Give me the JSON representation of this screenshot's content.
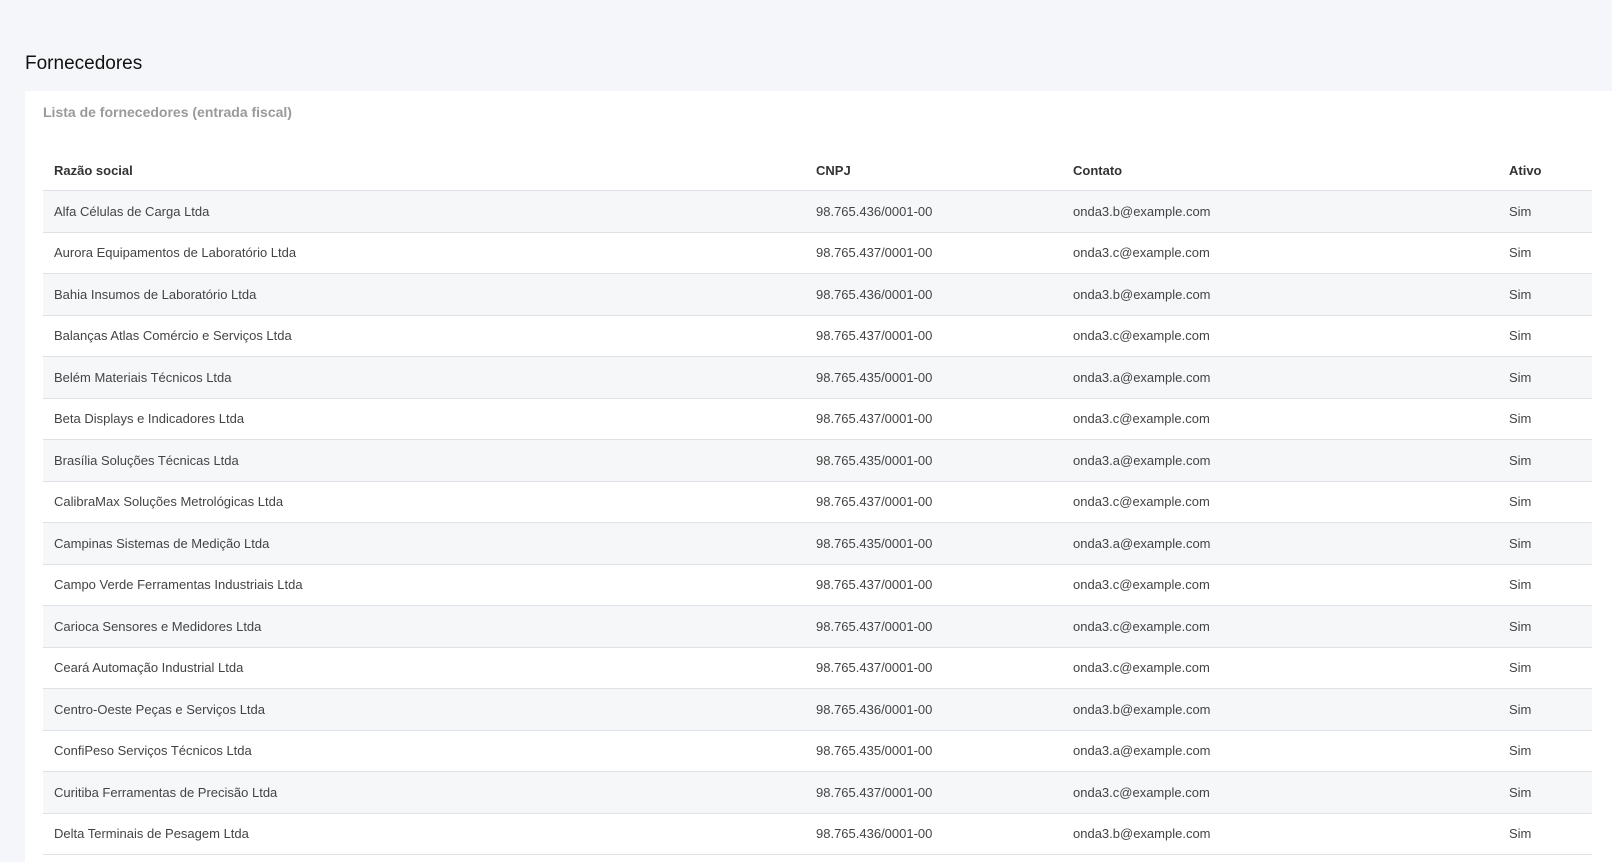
{
  "page": {
    "title": "Fornecedores"
  },
  "card": {
    "subtitle": "Lista de fornecedores (entrada fiscal)"
  },
  "table": {
    "columns": [
      "Razão social",
      "CNPJ",
      "Contato",
      "Ativo"
    ],
    "rows": [
      [
        "Alfa Células de Carga Ltda",
        "98.765.436/0001-00",
        "onda3.b@example.com",
        "Sim"
      ],
      [
        "Aurora Equipamentos de Laboratório Ltda",
        "98.765.437/0001-00",
        "onda3.c@example.com",
        "Sim"
      ],
      [
        "Bahia Insumos de Laboratório Ltda",
        "98.765.436/0001-00",
        "onda3.b@example.com",
        "Sim"
      ],
      [
        "Balanças Atlas Comércio e Serviços Ltda",
        "98.765.437/0001-00",
        "onda3.c@example.com",
        "Sim"
      ],
      [
        "Belém Materiais Técnicos Ltda",
        "98.765.435/0001-00",
        "onda3.a@example.com",
        "Sim"
      ],
      [
        "Beta Displays e Indicadores Ltda",
        "98.765.437/0001-00",
        "onda3.c@example.com",
        "Sim"
      ],
      [
        "Brasília Soluções Técnicas Ltda",
        "98.765.435/0001-00",
        "onda3.a@example.com",
        "Sim"
      ],
      [
        "CalibraMax Soluções Metrológicas Ltda",
        "98.765.437/0001-00",
        "onda3.c@example.com",
        "Sim"
      ],
      [
        "Campinas Sistemas de Medição Ltda",
        "98.765.435/0001-00",
        "onda3.a@example.com",
        "Sim"
      ],
      [
        "Campo Verde Ferramentas Industriais Ltda",
        "98.765.437/0001-00",
        "onda3.c@example.com",
        "Sim"
      ],
      [
        "Carioca Sensores e Medidores Ltda",
        "98.765.437/0001-00",
        "onda3.c@example.com",
        "Sim"
      ],
      [
        "Ceará Automação Industrial Ltda",
        "98.765.437/0001-00",
        "onda3.c@example.com",
        "Sim"
      ],
      [
        "Centro-Oeste Peças e Serviços Ltda",
        "98.765.436/0001-00",
        "onda3.b@example.com",
        "Sim"
      ],
      [
        "ConfiPeso Serviços Técnicos Ltda",
        "98.765.435/0001-00",
        "onda3.a@example.com",
        "Sim"
      ],
      [
        "Curitiba Ferramentas de Precisão Ltda",
        "98.765.437/0001-00",
        "onda3.c@example.com",
        "Sim"
      ],
      [
        "Delta Terminais de Pesagem Ltda",
        "98.765.436/0001-00",
        "onda3.b@example.com",
        "Sim"
      ]
    ]
  }
}
